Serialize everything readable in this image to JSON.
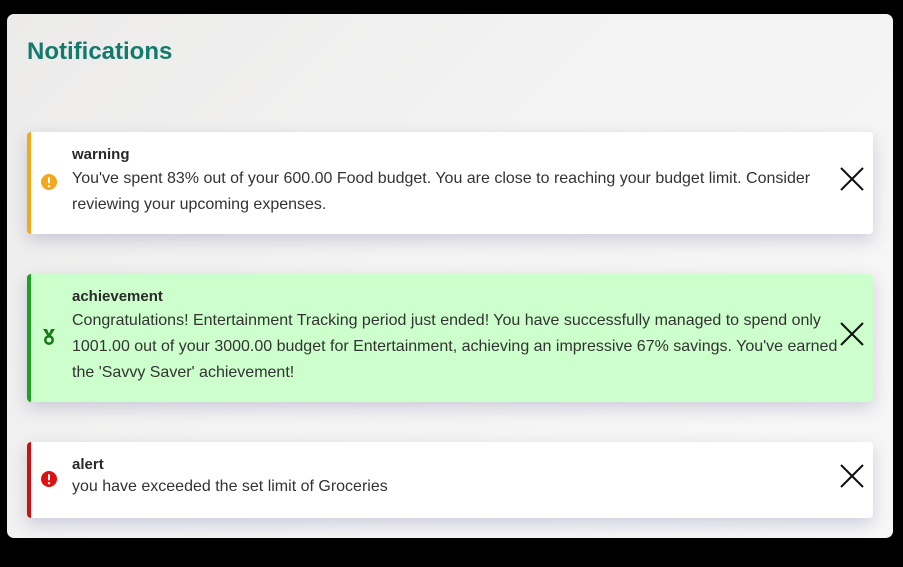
{
  "header": {
    "title": "Notifications"
  },
  "notifications": [
    {
      "type": "warning",
      "message": "You've spent 83% out of your 600.00 Food budget. You are close to reaching your budget limit. Consider reviewing your upcoming expenses.",
      "icon": "warning-circle-icon",
      "accent": "#f2a81d"
    },
    {
      "type": "achievement",
      "message": "Congratulations! Entertainment Tracking period just ended! You have successfully managed to spend only 1001.00 out of your 3000.00 budget for Entertainment, achieving an impressive 67% savings. You've earned the 'Savvy Saver' achievement!",
      "icon": "medal-icon",
      "accent": "#20a020"
    },
    {
      "type": "alert",
      "message": "you have exceeded the set limit of Groceries",
      "icon": "alert-circle-icon",
      "accent": "#d01010"
    }
  ],
  "close_icon": "close-icon"
}
